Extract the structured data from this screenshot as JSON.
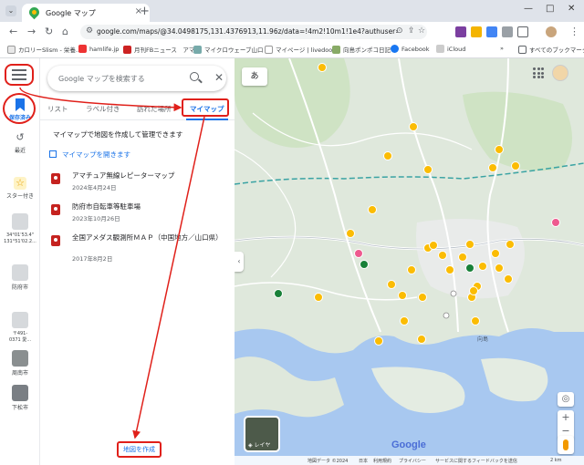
{
  "browser": {
    "tab_title": "Google マップ",
    "url": "google.com/maps/@34.0498175,131.4376913,11.96z/data=!4m2!10m1!1e4?authuser=0&entry=ttu",
    "bookmarks": [
      {
        "label": "カロリーSlism - 栄養..."
      },
      {
        "label": "hamlife.jp"
      },
      {
        "label": "月刊FBニュース　アマ..."
      },
      {
        "label": "マイクロウェーブ山口 -..."
      },
      {
        "label": "マイページ | livedoor..."
      },
      {
        "label": "向島ポンポコ日記"
      },
      {
        "label": "Facebook"
      },
      {
        "label": "iCloud"
      }
    ],
    "all_bookmarks": "すべてのブックマーク",
    "overflow": "»"
  },
  "rail": {
    "saved": "保存済み",
    "recent": "最近",
    "starred": "スター付き",
    "coord": "34°01'53.4\"\n131°51'02.2...",
    "place1": "防府市",
    "place2": "〒491-\n0371 愛...",
    "place3": "周南市",
    "place4": "下松市"
  },
  "panel": {
    "search_placeholder": "Google マップを検索する",
    "tabs": [
      "リスト",
      "ラベル付き",
      "訪れた場所",
      "マイマップ"
    ],
    "intro": "マイマップで地図を作成して管理できます",
    "open_link": "マイマップを開きます",
    "maps": [
      {
        "title": "アマチュア無線レピーターマップ",
        "date": "2024年4月24日"
      },
      {
        "title": "防府市自転車等駐車場",
        "date": "2023年10月26日"
      },
      {
        "title": "全国アメダス観測所ＭＡＰ（中国地方／山口県）",
        "date": "2017年8月2日"
      }
    ],
    "create_button": "地図を作成"
  },
  "map": {
    "lang_button": "あ",
    "layer_label": "レイヤ",
    "google": "Google",
    "place_label": "向島",
    "footer": [
      "地図データ ©2024",
      "日本",
      "利用規約",
      "プライバシー",
      "サービスに関するフィードバックを送信",
      "2 km"
    ]
  }
}
